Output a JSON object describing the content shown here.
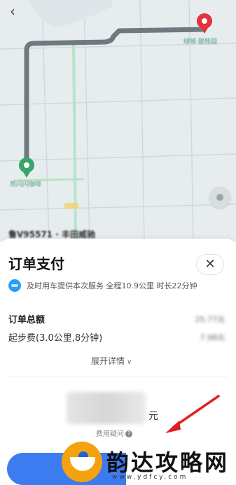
{
  "map": {
    "back_icon": "chevron-left-icon",
    "locate_icon": "locate-icon",
    "start_marker": "start-pin-icon",
    "end_marker": "end-pin-icon",
    "route_color": "#6f7a80",
    "start_color": "#3aa56a",
    "end_color": "#e5313b",
    "labels": [
      "绿城·碧桂园",
      "亮闪闪咖啡",
      "•"
    ],
    "vehicle_peek": "鲁V95571 · 丰田威驰"
  },
  "sheet": {
    "title": "订单支付",
    "close_icon": "close-icon",
    "service_logo": "service-logo-icon",
    "service_text": "及时用车提供本次服务 全程10.9公里 时长22分钟",
    "fees": {
      "total_label": "订单总额",
      "total_value": "25.77元",
      "base_label": "起步费(3.0公里,8分钟)",
      "base_value": "7.98元"
    },
    "expand_label": "展开详情",
    "expand_icon": "chevron-down-icon",
    "amount_unit": "元",
    "fee_question": "费用疑问",
    "fee_question_icon": "question-icon",
    "accent_color": "#3d7bf0"
  },
  "watermark": {
    "text": "韵达攻略网",
    "url": "www.ydfcy.com"
  }
}
